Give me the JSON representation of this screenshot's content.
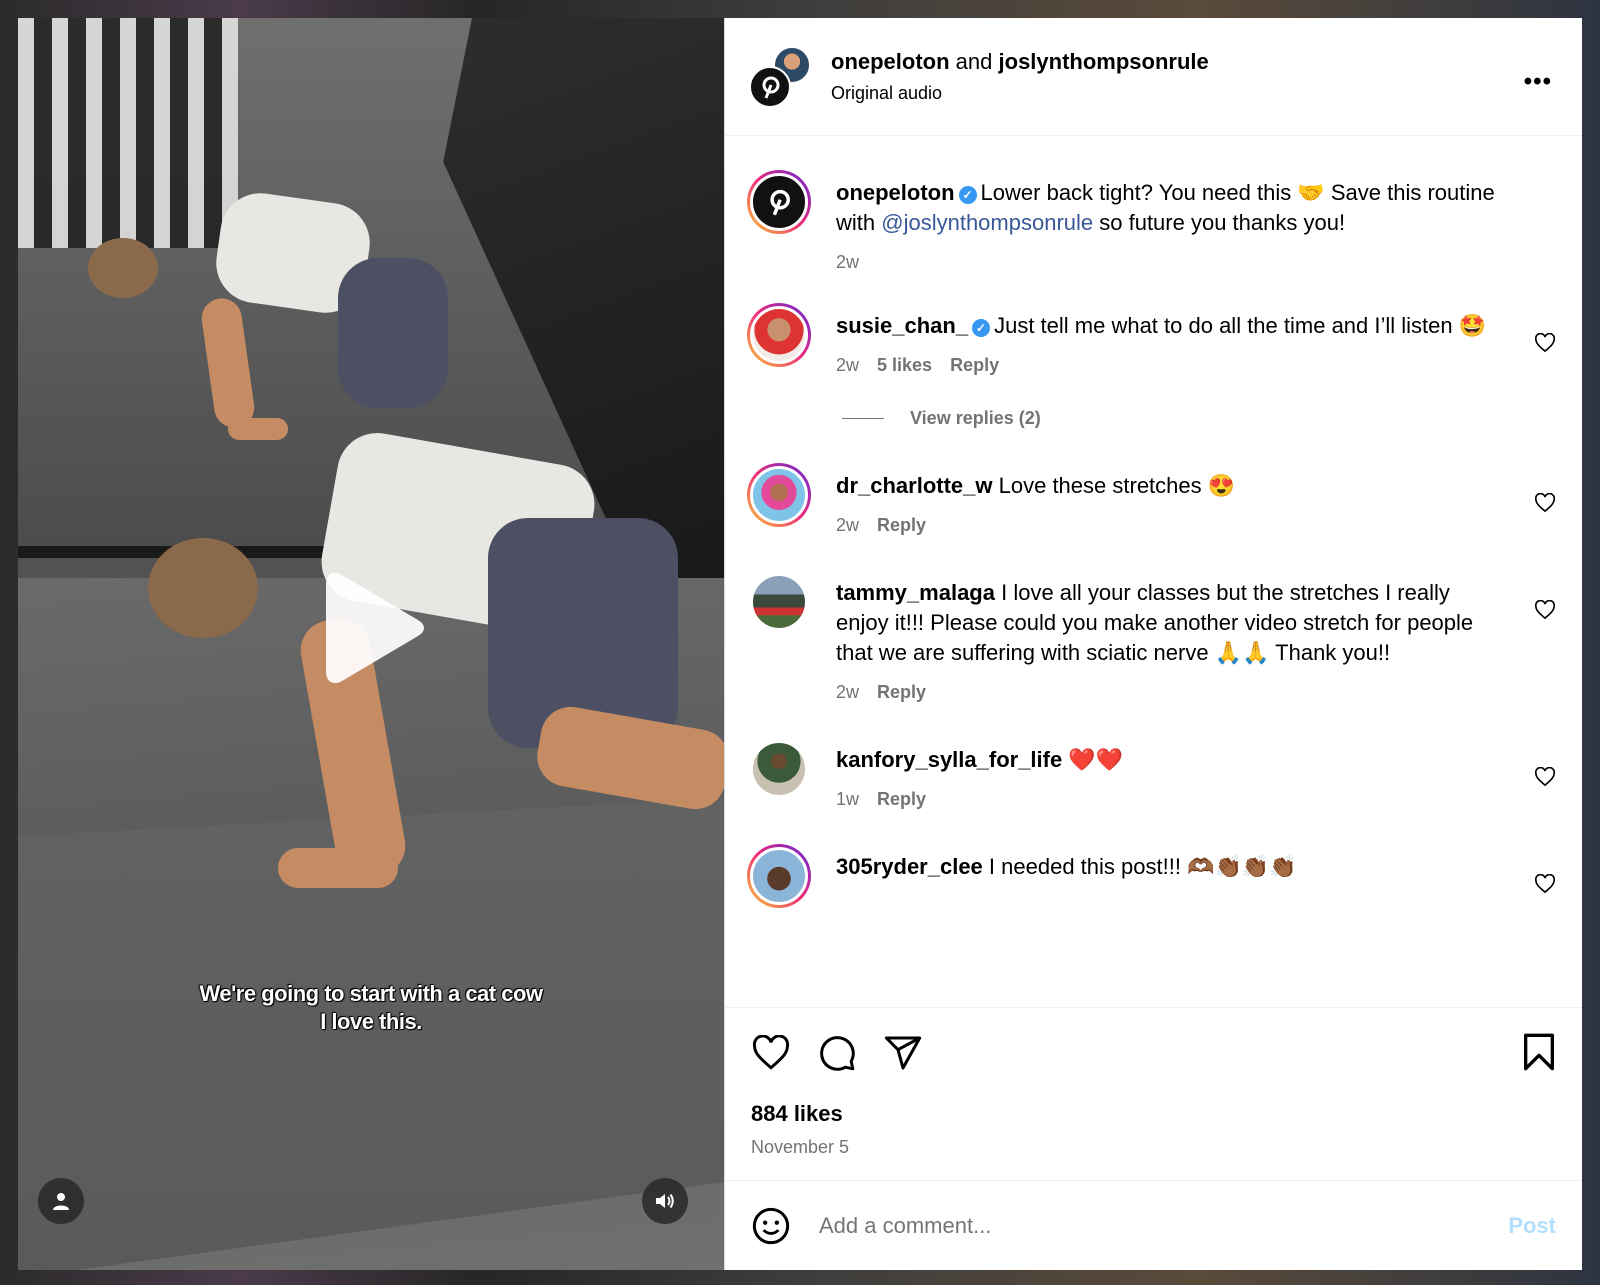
{
  "header": {
    "user1": "onepeloton",
    "and": "and",
    "user2": "joslynthompsonrule",
    "audio": "Original audio",
    "more": "•••"
  },
  "video": {
    "caption_line1": "We're going to start with a cat cow",
    "caption_line2": "I love this."
  },
  "caption_post": {
    "user": "onepeloton",
    "text_before": "Lower back tight? You need this 🤝 Save this routine with ",
    "mention": "@joslynthompsonrule",
    "text_after": " so future you thanks you!",
    "time": "2w"
  },
  "comments": [
    {
      "user": "susie_chan_",
      "verified": true,
      "text": "Just tell me what to do all the time and I’ll listen 🤩",
      "time": "2w",
      "likes": "5 likes",
      "reply": "Reply",
      "view_replies": "View replies (2)"
    },
    {
      "user": "dr_charlotte_w",
      "verified": false,
      "text": "Love these stretches 😍",
      "time": "2w",
      "likes": "",
      "reply": "Reply"
    },
    {
      "user": "tammy_malaga",
      "verified": false,
      "text": "I love all your classes but the stretches I really enjoy it!!! Please could you make another video stretch for people that we are suffering with sciatic nerve 🙏🙏 Thank you!!",
      "time": "2w",
      "likes": "",
      "reply": "Reply"
    },
    {
      "user": "kanfory_sylla_for_life",
      "verified": false,
      "text": "❤️❤️",
      "time": "1w",
      "likes": "",
      "reply": "Reply"
    },
    {
      "user": "305ryder_clee",
      "verified": false,
      "text": "I needed this post!!! 🫶🏾👏🏾👏🏾👏🏾",
      "time": "",
      "likes": "",
      "reply": ""
    }
  ],
  "post": {
    "likes": "884 likes",
    "date": "November 5"
  },
  "composer": {
    "placeholder": "Add a comment...",
    "post_label": "Post"
  },
  "colors": {
    "link": "#385898",
    "meta": "#737373",
    "verified": "#3897f0",
    "post_button": "#b2dffc"
  },
  "icons": [
    "more-icon",
    "verified-icon",
    "heart-icon",
    "comment-icon",
    "share-icon",
    "bookmark-icon",
    "emoji-icon",
    "play-icon",
    "user-tag-icon",
    "sound-icon"
  ]
}
